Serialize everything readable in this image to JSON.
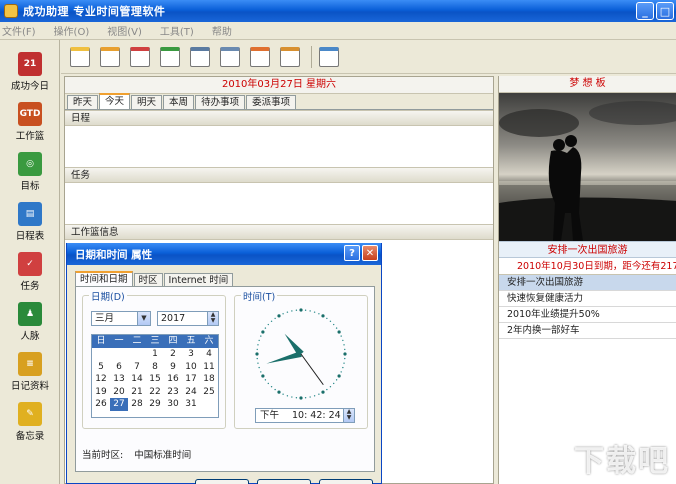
{
  "window": {
    "title": "成功助理  专业时间管理软件",
    "controls": {
      "minimize": "_",
      "maximize": "□"
    }
  },
  "menu": [
    "文件(F)",
    "操作(O)",
    "视图(V)",
    "工具(T)",
    "帮助"
  ],
  "nav": [
    {
      "label": "成功今日",
      "icon": "calendar-21-icon",
      "glyph": "21",
      "color": "#c03030"
    },
    {
      "label": "工作篮",
      "icon": "gtd-basket-icon",
      "glyph": "GTD",
      "color": "#c85020"
    },
    {
      "label": "目标",
      "icon": "target-icon",
      "glyph": "◎",
      "color": "#3a9a40"
    },
    {
      "label": "日程表",
      "icon": "schedule-icon",
      "glyph": "▤",
      "color": "#2f78c8"
    },
    {
      "label": "任务",
      "icon": "task-check-icon",
      "glyph": "✓",
      "color": "#d04040"
    },
    {
      "label": "人脉",
      "icon": "contacts-icon",
      "glyph": "♟",
      "color": "#2a8a3a"
    },
    {
      "label": "日记资料",
      "icon": "diary-books-icon",
      "glyph": "≡",
      "color": "#d8a020"
    },
    {
      "label": "备忘录",
      "icon": "memo-icon",
      "glyph": "✎",
      "color": "#e0b020"
    }
  ],
  "toolbar": [
    {
      "icon": "new-document-icon"
    },
    {
      "icon": "new-note-icon"
    },
    {
      "icon": "checklist-icon"
    },
    {
      "icon": "contact-person-icon"
    },
    {
      "icon": "list-document-icon"
    },
    {
      "icon": "document-settings-icon"
    },
    {
      "icon": "calendar-page-icon"
    },
    {
      "icon": "alarm-clock-icon"
    },
    {
      "icon": "magnifier-icon"
    }
  ],
  "main": {
    "date_header": "2010年03月27日 星期六",
    "tabs": [
      "昨天",
      "今天",
      "明天",
      "本周",
      "待办事项",
      "委派事项"
    ],
    "active_tab": 1,
    "sections": {
      "schedule": "日程",
      "tasks": "任务",
      "inbox_info": "工作篮信息"
    }
  },
  "right_panel": {
    "title": "梦 想 板",
    "goal_title": "安排一次出国旅游",
    "deadline": "2010年10月30日到期，距今还有217天",
    "goals": [
      {
        "label": "安排一次出国旅游",
        "selected": true
      },
      {
        "label": "快速恢复健康活力",
        "selected": false
      },
      {
        "label": "2010年业绩提升50%",
        "selected": false
      },
      {
        "label": "2年内换一部好车",
        "selected": false
      }
    ]
  },
  "dialog": {
    "title": "日期和时间 属性",
    "help": "?",
    "close": "✕",
    "tabs": [
      "时间和日期",
      "时区",
      "Internet 时间"
    ],
    "active_tab": 0,
    "date_group": "日期(D)",
    "month": "三月",
    "year": "2017",
    "weekdays": [
      "一",
      "二",
      "三",
      "四",
      "五",
      "六"
    ],
    "weekdays_first": "日",
    "calendar_rows": [
      [
        "",
        "",
        "",
        "1",
        "2",
        "3",
        "4"
      ],
      [
        "5",
        "6",
        "7",
        "8",
        "9",
        "10",
        "11"
      ],
      [
        "12",
        "13",
        "14",
        "15",
        "16",
        "17",
        "18"
      ],
      [
        "19",
        "20",
        "21",
        "22",
        "23",
        "24",
        "25"
      ],
      [
        "26",
        "27",
        "28",
        "29",
        "30",
        "31",
        ""
      ]
    ],
    "selected_day": "27",
    "time_group": "时间(T)",
    "ampm": "下午",
    "time": "10: 42: 24",
    "clock": {
      "hour": 10,
      "minute": 42,
      "second": 24
    },
    "timezone_label": "当前时区:",
    "timezone_value": "中国标准时间"
  },
  "watermark": "下载吧"
}
